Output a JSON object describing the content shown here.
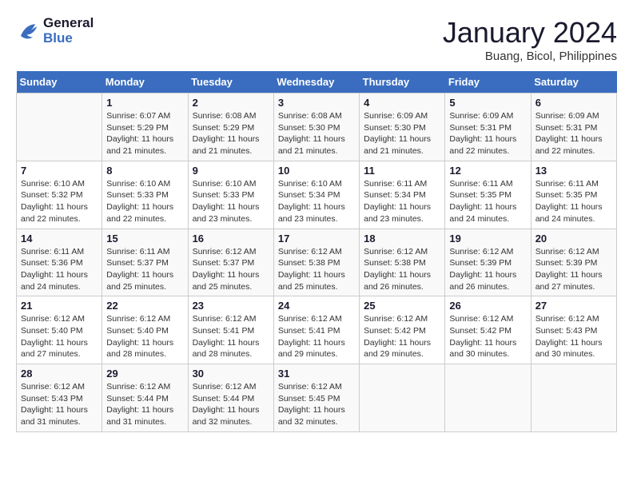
{
  "logo": {
    "line1": "General",
    "line2": "Blue"
  },
  "title": "January 2024",
  "location": "Buang, Bicol, Philippines",
  "days_of_week": [
    "Sunday",
    "Monday",
    "Tuesday",
    "Wednesday",
    "Thursday",
    "Friday",
    "Saturday"
  ],
  "weeks": [
    [
      {
        "day": "",
        "sunrise": "",
        "sunset": "",
        "daylight": ""
      },
      {
        "day": "1",
        "sunrise": "Sunrise: 6:07 AM",
        "sunset": "Sunset: 5:29 PM",
        "daylight": "Daylight: 11 hours and 21 minutes."
      },
      {
        "day": "2",
        "sunrise": "Sunrise: 6:08 AM",
        "sunset": "Sunset: 5:29 PM",
        "daylight": "Daylight: 11 hours and 21 minutes."
      },
      {
        "day": "3",
        "sunrise": "Sunrise: 6:08 AM",
        "sunset": "Sunset: 5:30 PM",
        "daylight": "Daylight: 11 hours and 21 minutes."
      },
      {
        "day": "4",
        "sunrise": "Sunrise: 6:09 AM",
        "sunset": "Sunset: 5:30 PM",
        "daylight": "Daylight: 11 hours and 21 minutes."
      },
      {
        "day": "5",
        "sunrise": "Sunrise: 6:09 AM",
        "sunset": "Sunset: 5:31 PM",
        "daylight": "Daylight: 11 hours and 22 minutes."
      },
      {
        "day": "6",
        "sunrise": "Sunrise: 6:09 AM",
        "sunset": "Sunset: 5:31 PM",
        "daylight": "Daylight: 11 hours and 22 minutes."
      }
    ],
    [
      {
        "day": "7",
        "sunrise": "Sunrise: 6:10 AM",
        "sunset": "Sunset: 5:32 PM",
        "daylight": "Daylight: 11 hours and 22 minutes."
      },
      {
        "day": "8",
        "sunrise": "Sunrise: 6:10 AM",
        "sunset": "Sunset: 5:33 PM",
        "daylight": "Daylight: 11 hours and 22 minutes."
      },
      {
        "day": "9",
        "sunrise": "Sunrise: 6:10 AM",
        "sunset": "Sunset: 5:33 PM",
        "daylight": "Daylight: 11 hours and 23 minutes."
      },
      {
        "day": "10",
        "sunrise": "Sunrise: 6:10 AM",
        "sunset": "Sunset: 5:34 PM",
        "daylight": "Daylight: 11 hours and 23 minutes."
      },
      {
        "day": "11",
        "sunrise": "Sunrise: 6:11 AM",
        "sunset": "Sunset: 5:34 PM",
        "daylight": "Daylight: 11 hours and 23 minutes."
      },
      {
        "day": "12",
        "sunrise": "Sunrise: 6:11 AM",
        "sunset": "Sunset: 5:35 PM",
        "daylight": "Daylight: 11 hours and 24 minutes."
      },
      {
        "day": "13",
        "sunrise": "Sunrise: 6:11 AM",
        "sunset": "Sunset: 5:35 PM",
        "daylight": "Daylight: 11 hours and 24 minutes."
      }
    ],
    [
      {
        "day": "14",
        "sunrise": "Sunrise: 6:11 AM",
        "sunset": "Sunset: 5:36 PM",
        "daylight": "Daylight: 11 hours and 24 minutes."
      },
      {
        "day": "15",
        "sunrise": "Sunrise: 6:11 AM",
        "sunset": "Sunset: 5:37 PM",
        "daylight": "Daylight: 11 hours and 25 minutes."
      },
      {
        "day": "16",
        "sunrise": "Sunrise: 6:12 AM",
        "sunset": "Sunset: 5:37 PM",
        "daylight": "Daylight: 11 hours and 25 minutes."
      },
      {
        "day": "17",
        "sunrise": "Sunrise: 6:12 AM",
        "sunset": "Sunset: 5:38 PM",
        "daylight": "Daylight: 11 hours and 25 minutes."
      },
      {
        "day": "18",
        "sunrise": "Sunrise: 6:12 AM",
        "sunset": "Sunset: 5:38 PM",
        "daylight": "Daylight: 11 hours and 26 minutes."
      },
      {
        "day": "19",
        "sunrise": "Sunrise: 6:12 AM",
        "sunset": "Sunset: 5:39 PM",
        "daylight": "Daylight: 11 hours and 26 minutes."
      },
      {
        "day": "20",
        "sunrise": "Sunrise: 6:12 AM",
        "sunset": "Sunset: 5:39 PM",
        "daylight": "Daylight: 11 hours and 27 minutes."
      }
    ],
    [
      {
        "day": "21",
        "sunrise": "Sunrise: 6:12 AM",
        "sunset": "Sunset: 5:40 PM",
        "daylight": "Daylight: 11 hours and 27 minutes."
      },
      {
        "day": "22",
        "sunrise": "Sunrise: 6:12 AM",
        "sunset": "Sunset: 5:40 PM",
        "daylight": "Daylight: 11 hours and 28 minutes."
      },
      {
        "day": "23",
        "sunrise": "Sunrise: 6:12 AM",
        "sunset": "Sunset: 5:41 PM",
        "daylight": "Daylight: 11 hours and 28 minutes."
      },
      {
        "day": "24",
        "sunrise": "Sunrise: 6:12 AM",
        "sunset": "Sunset: 5:41 PM",
        "daylight": "Daylight: 11 hours and 29 minutes."
      },
      {
        "day": "25",
        "sunrise": "Sunrise: 6:12 AM",
        "sunset": "Sunset: 5:42 PM",
        "daylight": "Daylight: 11 hours and 29 minutes."
      },
      {
        "day": "26",
        "sunrise": "Sunrise: 6:12 AM",
        "sunset": "Sunset: 5:42 PM",
        "daylight": "Daylight: 11 hours and 30 minutes."
      },
      {
        "day": "27",
        "sunrise": "Sunrise: 6:12 AM",
        "sunset": "Sunset: 5:43 PM",
        "daylight": "Daylight: 11 hours and 30 minutes."
      }
    ],
    [
      {
        "day": "28",
        "sunrise": "Sunrise: 6:12 AM",
        "sunset": "Sunset: 5:43 PM",
        "daylight": "Daylight: 11 hours and 31 minutes."
      },
      {
        "day": "29",
        "sunrise": "Sunrise: 6:12 AM",
        "sunset": "Sunset: 5:44 PM",
        "daylight": "Daylight: 11 hours and 31 minutes."
      },
      {
        "day": "30",
        "sunrise": "Sunrise: 6:12 AM",
        "sunset": "Sunset: 5:44 PM",
        "daylight": "Daylight: 11 hours and 32 minutes."
      },
      {
        "day": "31",
        "sunrise": "Sunrise: 6:12 AM",
        "sunset": "Sunset: 5:45 PM",
        "daylight": "Daylight: 11 hours and 32 minutes."
      },
      {
        "day": "",
        "sunrise": "",
        "sunset": "",
        "daylight": ""
      },
      {
        "day": "",
        "sunrise": "",
        "sunset": "",
        "daylight": ""
      },
      {
        "day": "",
        "sunrise": "",
        "sunset": "",
        "daylight": ""
      }
    ]
  ]
}
